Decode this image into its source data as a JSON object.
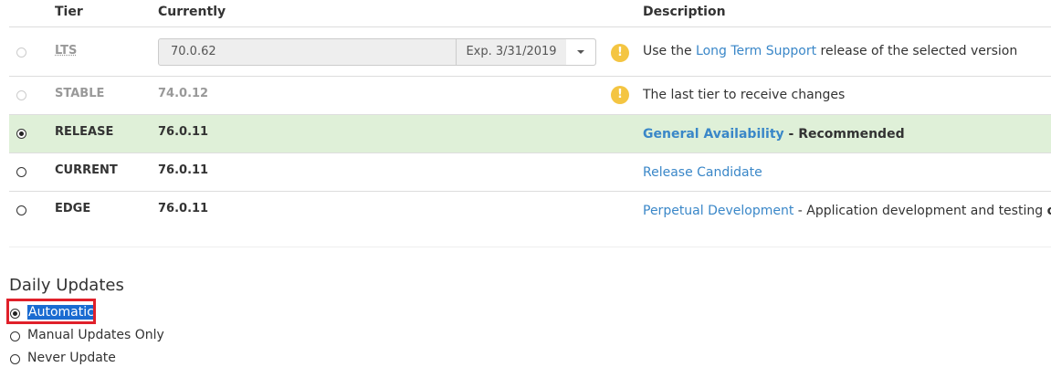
{
  "table": {
    "headers": {
      "tier": "Tier",
      "currently": "Currently",
      "description": "Description"
    },
    "rows": [
      {
        "tier": "LTS",
        "version": "70.0.62",
        "expiry": "Exp. 3/31/2019",
        "desc_link": "Long Term Support",
        "desc_pre": "Use the ",
        "desc_post": " release of the selected version",
        "selected": false,
        "disabled": true
      },
      {
        "tier": "STABLE",
        "version": "74.0.12",
        "desc_text": "The last tier to receive changes",
        "selected": false,
        "disabled": true
      },
      {
        "tier": "RELEASE",
        "version": "76.0.11",
        "desc_link": "General Availability",
        "desc_post": " - Recommended",
        "selected": true,
        "disabled": false
      },
      {
        "tier": "CURRENT",
        "version": "76.0.11",
        "desc_link": "Release Candidate",
        "selected": false,
        "disabled": false
      },
      {
        "tier": "EDGE",
        "version": "76.0.11",
        "desc_link": "Perpetual Development",
        "desc_post": " - Application development and testing ",
        "desc_bold_end": "only",
        "desc_end": ".",
        "selected": false,
        "disabled": false
      }
    ]
  },
  "warning_glyph": "!",
  "daily_updates": {
    "title": "Daily Updates",
    "options": [
      {
        "label": "Automatic",
        "selected": true
      },
      {
        "label": "Manual Updates Only",
        "selected": false
      },
      {
        "label": "Never Update",
        "selected": false
      }
    ]
  },
  "colors": {
    "link": "#3a87c8",
    "recommended_bg": "#dff0d8",
    "warning": "#f4c542",
    "highlight_border": "#e0202a",
    "selection_bg": "#1a6bd1"
  },
  "icons": {
    "warning": "exclamation-circle-icon",
    "dropdown": "caret-down-icon"
  }
}
